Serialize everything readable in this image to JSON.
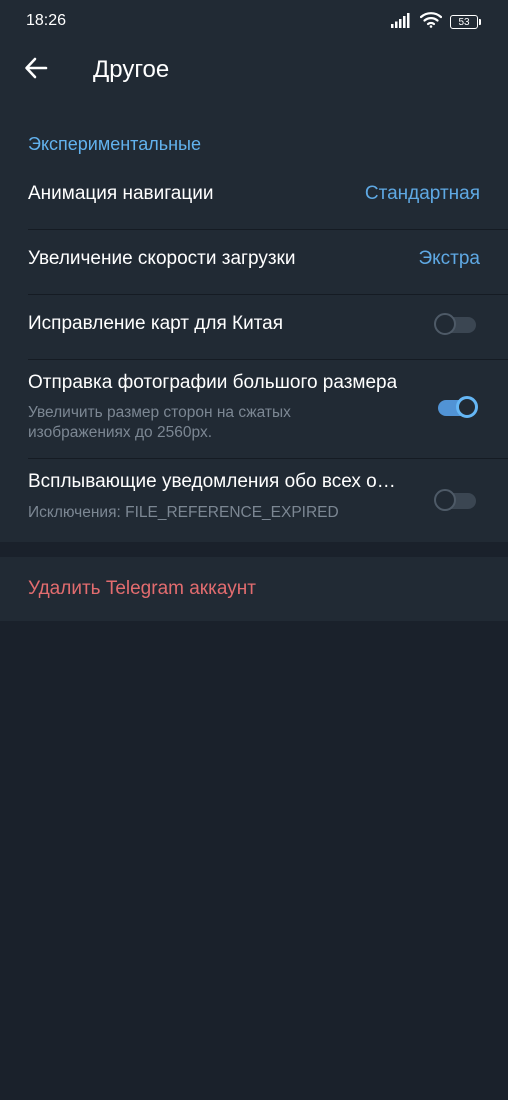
{
  "status_bar": {
    "time": "18:26",
    "battery": "53",
    "icons": [
      "signal-icon",
      "wifi-icon",
      "battery-icon"
    ]
  },
  "header": {
    "title": "Другое",
    "back_icon": "arrow-left-icon"
  },
  "section": {
    "header": "Экспериментальные",
    "items": [
      {
        "title": "Анимация навигации",
        "value": "Стандартная"
      },
      {
        "title": "Увеличение скорости загрузки",
        "value": "Экстра"
      },
      {
        "title": "Исправление карт для Китая",
        "toggle": false
      },
      {
        "title": "Отправка фотографии большого размера",
        "subtitle_line1": "Увеличить размер сторон на сжатых",
        "subtitle_line2": "изображениях до 2560px.",
        "toggle": true
      },
      {
        "title": "Всплывающие уведомления обо всех ошибках",
        "subtitle": "Исключения: FILE_REFERENCE_EXPIRED",
        "toggle": false
      }
    ]
  },
  "danger": {
    "label": "Удалить Telegram аккаунт"
  },
  "colors": {
    "background": "#1a212b",
    "surface": "#212a34",
    "accent": "#62b2ee",
    "danger": "#e26c6f",
    "toggle_on": "#5193d5"
  }
}
